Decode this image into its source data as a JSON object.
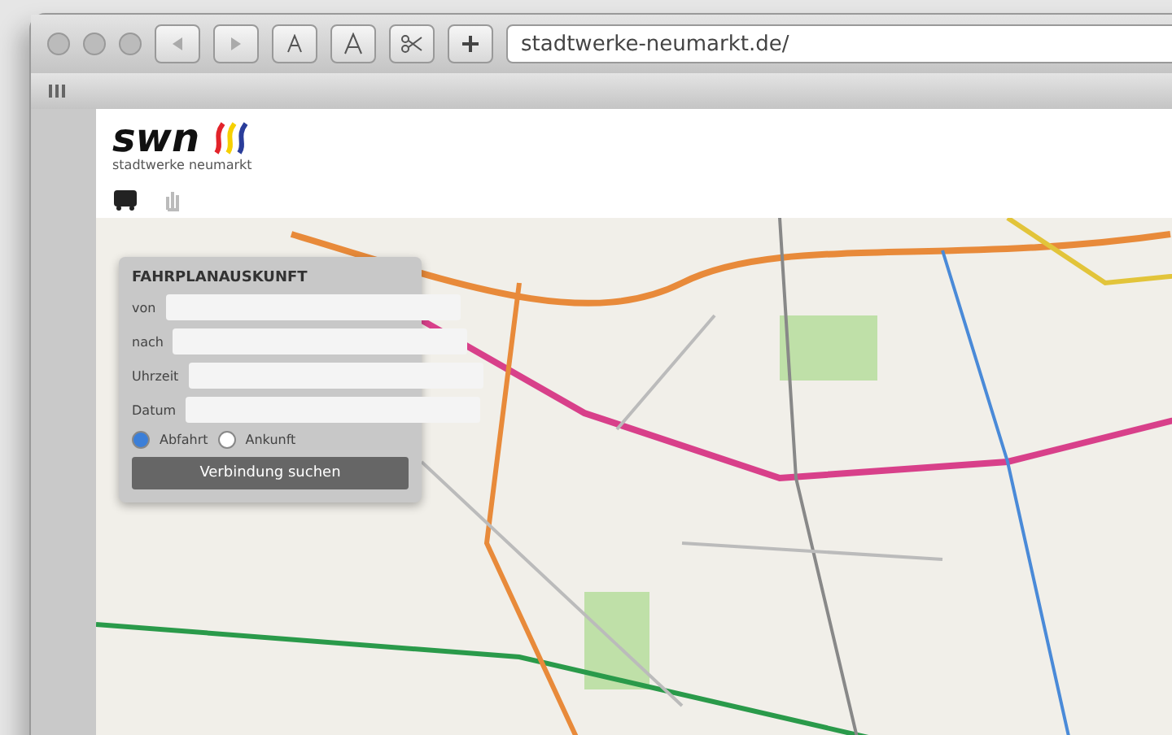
{
  "browser": {
    "address": "stadtwerke-neumarkt.de/"
  },
  "site": {
    "logo": "swn",
    "tagline": "stadtwerke neumarkt"
  },
  "planner": {
    "title": "FAHRPLANAUSKUNFT",
    "fields": [
      {
        "label": "von"
      },
      {
        "label": "nach"
      },
      {
        "label": "Uhrzeit"
      },
      {
        "label": "Datum"
      }
    ],
    "modes": [
      {
        "label": "Abfahrt",
        "selected": true
      },
      {
        "label": "Ankunft",
        "selected": false
      }
    ],
    "button": "Verbindung suchen"
  }
}
